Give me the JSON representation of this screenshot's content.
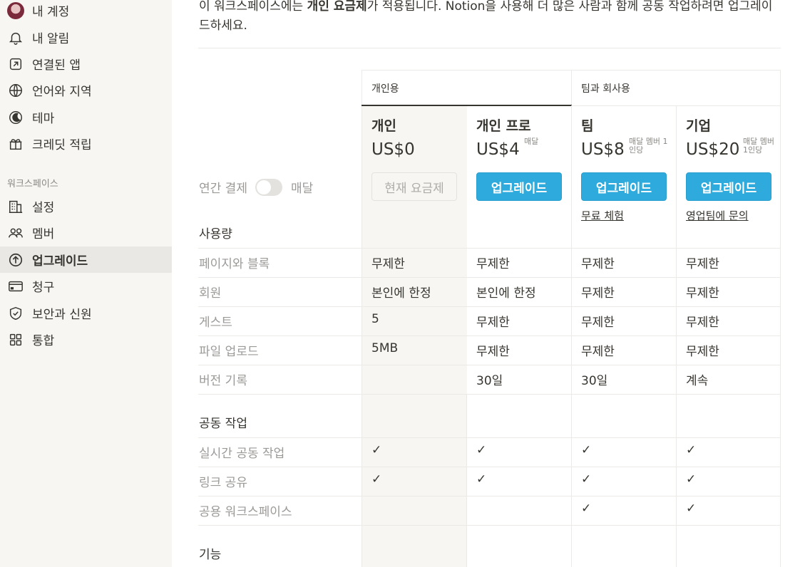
{
  "sidebar": {
    "account": [
      {
        "label": "내 계정",
        "icon": "avatar"
      },
      {
        "label": "내 알림",
        "icon": "bell-icon"
      },
      {
        "label": "연결된 앱",
        "icon": "external-link-icon"
      },
      {
        "label": "언어와 지역",
        "icon": "globe-icon"
      },
      {
        "label": "테마",
        "icon": "moon-icon"
      },
      {
        "label": "크레딧 적립",
        "icon": "gift-icon"
      }
    ],
    "workspace_heading": "워크스페이스",
    "workspace": [
      {
        "label": "설정",
        "icon": "building-icon"
      },
      {
        "label": "멤버",
        "icon": "members-icon"
      },
      {
        "label": "업그레이드",
        "icon": "upgrade-icon",
        "active": true
      },
      {
        "label": "청구",
        "icon": "credit-card-icon"
      },
      {
        "label": "보안과 신원",
        "icon": "shield-icon"
      },
      {
        "label": "통합",
        "icon": "grid-icon"
      }
    ]
  },
  "intro": {
    "pre": "이 워크스페이스에는 ",
    "bold": "개인 요금제",
    "post": "가 적용됩니다. Notion을 사용해 더 많은 사람과 함께 공동 작업하려면 업그레이드하세요."
  },
  "groups": {
    "personal": "개인용",
    "team": "팀과 회사용"
  },
  "billing": {
    "annual": "연간 결제",
    "monthly": "매달"
  },
  "plans": [
    {
      "name": "개인",
      "price": "US$0",
      "unit": "",
      "button": "현재 요금제",
      "button_type": "disabled",
      "link": ""
    },
    {
      "name": "개인 프로",
      "price": "US$4",
      "unit": "매달",
      "button": "업그레이드",
      "button_type": "primary",
      "link": ""
    },
    {
      "name": "팀",
      "price": "US$8",
      "unit": "매달 멤버 1인당",
      "button": "업그레이드",
      "button_type": "primary",
      "link": "무료 체험"
    },
    {
      "name": "기업",
      "price": "US$20",
      "unit": "매달 멤버 1인당",
      "button": "업그레이드",
      "button_type": "primary",
      "link": "영업팀에 문의"
    }
  ],
  "sections": [
    {
      "title": "사용량",
      "rows": [
        {
          "label": "페이지와 블록",
          "values": [
            "무제한",
            "무제한",
            "무제한",
            "무제한"
          ]
        },
        {
          "label": "회원",
          "values": [
            "본인에 한정",
            "본인에 한정",
            "무제한",
            "무제한"
          ]
        },
        {
          "label": "게스트",
          "values": [
            "5",
            "무제한",
            "무제한",
            "무제한"
          ]
        },
        {
          "label": "파일 업로드",
          "values": [
            "5MB",
            "무제한",
            "무제한",
            "무제한"
          ]
        },
        {
          "label": "버전 기록",
          "values": [
            "",
            "30일",
            "30일",
            "계속"
          ]
        }
      ]
    },
    {
      "title": "공동 작업",
      "rows": [
        {
          "label": "실시간 공동 작업",
          "values": [
            "✓",
            "✓",
            "✓",
            "✓"
          ]
        },
        {
          "label": "링크 공유",
          "values": [
            "✓",
            "✓",
            "✓",
            "✓"
          ]
        },
        {
          "label": "공용 워크스페이스",
          "values": [
            "",
            "",
            "✓",
            "✓"
          ]
        }
      ]
    },
    {
      "title": "기능",
      "rows": []
    }
  ]
}
